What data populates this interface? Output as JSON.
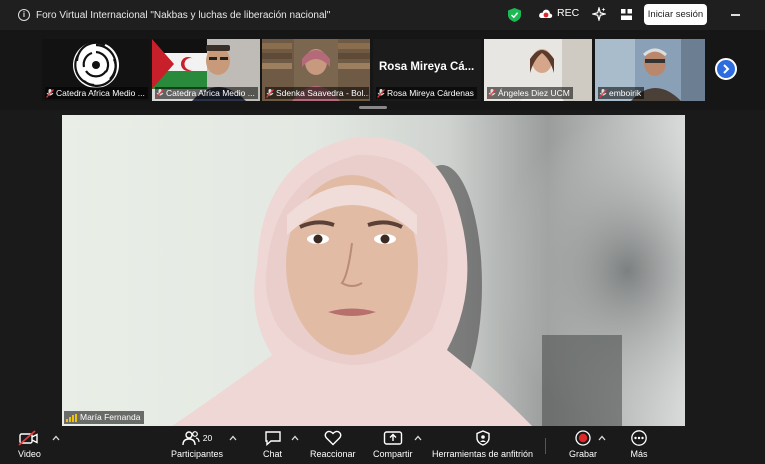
{
  "window": {
    "title": "Foro Virtual Internacional \"Nakbas y luchas de liberación nacional\"",
    "rec_label": "REC",
    "signin_label": "Iniciar sesión"
  },
  "participants_strip": [
    {
      "name": "Catedra Africa Medio ..."
    },
    {
      "name": "Catedra Africa Medio ..."
    },
    {
      "name": "Sdenka Saavedra - Bol..."
    },
    {
      "name": "Rosa Mireya Cárdenas",
      "big_name": "Rosa Mireya Cá..."
    },
    {
      "name": "Ángeles Diez UCM"
    },
    {
      "name": "emboirik"
    }
  ],
  "main_video": {
    "speaker_name": "María Fernanda"
  },
  "toolbar": {
    "video_label": "Video",
    "participants_label": "Participantes",
    "participants_count": "20",
    "chat_label": "Chat",
    "reactions_label": "Reaccionar",
    "share_label": "Compartir",
    "host_tools_label": "Herramientas de anfitrión",
    "record_label": "Grabar",
    "more_label": "Más"
  },
  "colors": {
    "accent_blue": "#2d6cdf",
    "shield_green": "#1db954",
    "record_red": "#e02828",
    "mic_muted_red": "#e03c3c"
  }
}
